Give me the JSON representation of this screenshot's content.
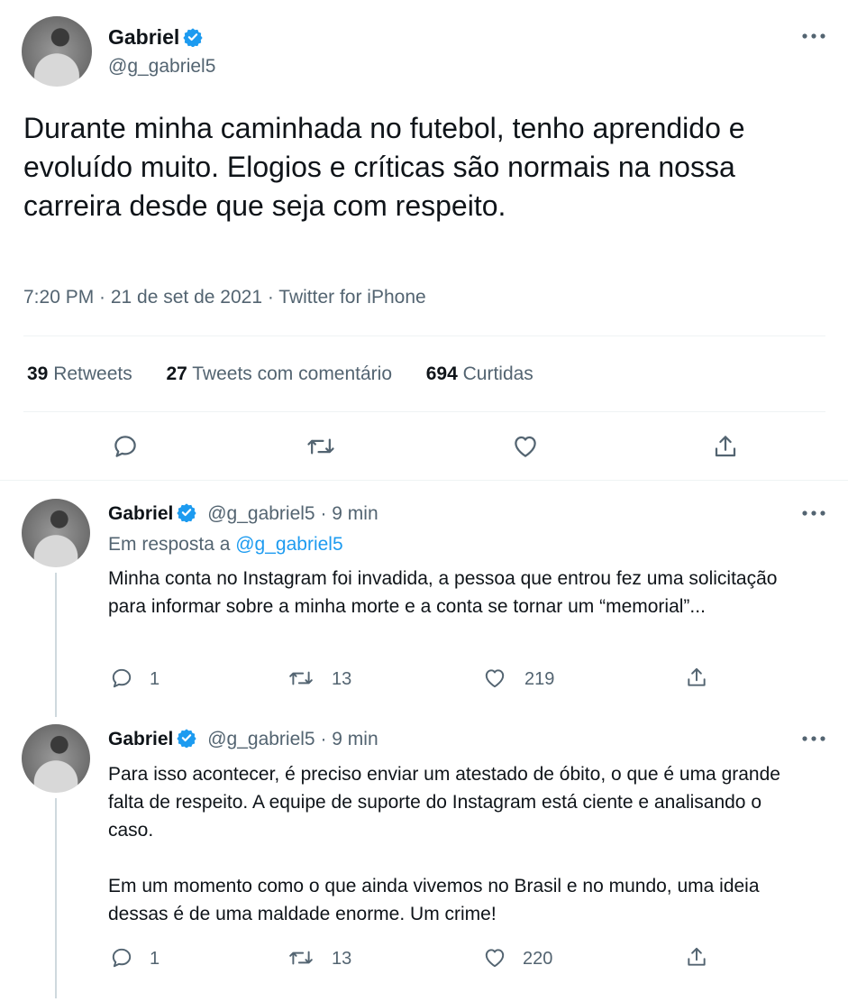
{
  "main_tweet": {
    "name": "Gabriel",
    "handle": "@g_gabriel5",
    "text": "Durante minha caminhada no futebol, tenho aprendido e evoluído muito. Elogios e críticas são normais na nossa carreira desde que seja com respeito.",
    "meta": "7:20 PM · 21 de set de 2021 · Twitter for iPhone",
    "stats": {
      "retweets_count": "39",
      "retweets_label": "Retweets",
      "quotes_count": "27",
      "quotes_label": "Tweets com comentário",
      "likes_count": "694",
      "likes_label": "Curtidas"
    }
  },
  "replies": [
    {
      "name": "Gabriel",
      "handle_time": "@g_gabriel5 · 9 min",
      "reply_prefix": "Em resposta a ",
      "reply_to": "@g_gabriel5",
      "text": "Minha conta no Instagram foi invadida, a pessoa que entrou fez uma solicitação para informar sobre a minha morte e a conta se tornar um “memorial”...",
      "reply_count": "1",
      "retweet_count": "13",
      "like_count": "219"
    },
    {
      "name": "Gabriel",
      "handle_time": "@g_gabriel5 · 9 min",
      "text": "Para isso acontecer, é preciso enviar um atestado de óbito, o que é uma grande falta de respeito. A equipe de suporte do Instagram está ciente e analisando o caso.\n\nEm um momento como o que ainda vivemos no Brasil e no mundo, uma ideia dessas é de uma maldade enorme. Um crime!",
      "reply_count": "1",
      "retweet_count": "13",
      "like_count": "220"
    }
  ],
  "colors": {
    "verified": "#1d9bf0",
    "link": "#1d9bf0",
    "muted": "#536471",
    "text": "#0f1419"
  }
}
